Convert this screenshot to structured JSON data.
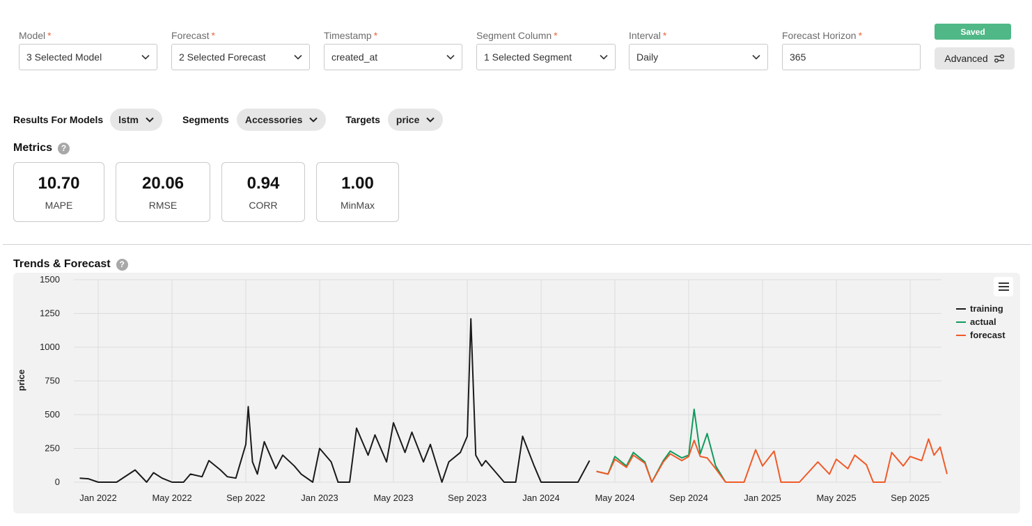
{
  "fields": [
    {
      "label": "Model",
      "value": "3 Selected Model",
      "kind": "select"
    },
    {
      "label": "Forecast",
      "value": "2 Selected Forecast",
      "kind": "select"
    },
    {
      "label": "Timestamp",
      "value": "created_at",
      "kind": "select"
    },
    {
      "label": "Segment Column",
      "value": "1 Selected Segment",
      "kind": "select"
    },
    {
      "label": "Interval",
      "value": "Daily",
      "kind": "select"
    },
    {
      "label": "Forecast Horizon",
      "value": "365",
      "kind": "input"
    }
  ],
  "required_mark": "*",
  "saved_label": "Saved",
  "advanced_label": "Advanced",
  "filters": {
    "models_label": "Results For Models",
    "models_value": "lstm",
    "segments_label": "Segments",
    "segments_value": "Accessories",
    "targets_label": "Targets",
    "targets_value": "price"
  },
  "metrics_title": "Metrics",
  "help_glyph": "?",
  "metrics": [
    {
      "value": "10.70",
      "name": "MAPE"
    },
    {
      "value": "20.06",
      "name": "RMSE"
    },
    {
      "value": "0.94",
      "name": "CORR"
    },
    {
      "value": "1.00",
      "name": "MinMax"
    }
  ],
  "chart_title": "Trends & Forecast",
  "chart_data": {
    "type": "line",
    "ylabel": "price",
    "ylim": [
      0,
      1500
    ],
    "yticks": [
      0,
      250,
      500,
      750,
      1000,
      1250,
      1500
    ],
    "xticks": [
      "Jan 2022",
      "May 2022",
      "Sep 2022",
      "Jan 2023",
      "May 2023",
      "Sep 2023",
      "Jan 2024",
      "May 2024",
      "Sep 2024",
      "Jan 2025",
      "May 2025",
      "Sep 2025"
    ],
    "grid": true,
    "legend_position": "right",
    "series": [
      {
        "name": "training",
        "color": "#1a1a1a",
        "x": [
          "2021-12-01",
          "2021-12-15",
          "2022-01-01",
          "2022-02-01",
          "2022-03-01",
          "2022-03-20",
          "2022-04-01",
          "2022-04-15",
          "2022-05-01",
          "2022-05-20",
          "2022-06-01",
          "2022-06-20",
          "2022-07-01",
          "2022-07-20",
          "2022-08-01",
          "2022-08-15",
          "2022-09-01",
          "2022-09-05",
          "2022-09-12",
          "2022-09-20",
          "2022-10-01",
          "2022-10-20",
          "2022-11-01",
          "2022-11-20",
          "2022-12-01",
          "2022-12-20",
          "2023-01-01",
          "2023-01-20",
          "2023-02-01",
          "2023-02-20",
          "2023-03-01",
          "2023-03-20",
          "2023-04-01",
          "2023-04-20",
          "2023-05-01",
          "2023-05-20",
          "2023-06-01",
          "2023-06-20",
          "2023-07-01",
          "2023-07-20",
          "2023-08-01",
          "2023-08-20",
          "2023-09-01",
          "2023-09-07",
          "2023-09-15",
          "2023-09-25",
          "2023-10-01",
          "2023-10-20",
          "2023-11-01",
          "2023-11-20",
          "2023-12-01",
          "2023-12-20",
          "2024-01-01",
          "2024-02-01",
          "2024-03-01",
          "2024-03-20"
        ],
        "y": [
          30,
          25,
          0,
          0,
          90,
          0,
          70,
          30,
          0,
          0,
          60,
          40,
          160,
          90,
          40,
          30,
          280,
          560,
          150,
          60,
          300,
          100,
          200,
          120,
          60,
          0,
          250,
          150,
          0,
          0,
          400,
          200,
          350,
          150,
          440,
          220,
          370,
          150,
          280,
          0,
          150,
          220,
          340,
          1210,
          200,
          120,
          160,
          60,
          0,
          0,
          340,
          120,
          0,
          0,
          0,
          160
        ]
      },
      {
        "name": "actual",
        "color": "#0f9a5c",
        "x": [
          "2024-04-01",
          "2024-04-20",
          "2024-05-01",
          "2024-05-20",
          "2024-06-01",
          "2024-06-20",
          "2024-07-01",
          "2024-07-20",
          "2024-08-01",
          "2024-08-20",
          "2024-09-01",
          "2024-09-10",
          "2024-09-20",
          "2024-10-01",
          "2024-10-15",
          "2024-11-01"
        ],
        "y": [
          80,
          60,
          190,
          120,
          220,
          150,
          0,
          160,
          230,
          180,
          200,
          540,
          210,
          360,
          120,
          0
        ]
      },
      {
        "name": "forecast",
        "color": "#f05a28",
        "x": [
          "2024-04-01",
          "2024-04-20",
          "2024-05-01",
          "2024-05-20",
          "2024-06-01",
          "2024-06-20",
          "2024-07-01",
          "2024-07-20",
          "2024-08-01",
          "2024-08-20",
          "2024-09-01",
          "2024-09-10",
          "2024-09-20",
          "2024-10-01",
          "2024-10-15",
          "2024-11-01",
          "2024-12-01",
          "2024-12-20",
          "2025-01-01",
          "2025-01-20",
          "2025-02-01",
          "2025-03-01",
          "2025-04-01",
          "2025-04-20",
          "2025-05-01",
          "2025-05-20",
          "2025-06-01",
          "2025-06-20",
          "2025-07-01",
          "2025-07-20",
          "2025-08-01",
          "2025-08-20",
          "2025-09-01",
          "2025-09-20",
          "2025-10-01",
          "2025-10-10",
          "2025-10-20",
          "2025-11-01"
        ],
        "y": [
          80,
          60,
          170,
          110,
          200,
          140,
          0,
          150,
          210,
          160,
          190,
          310,
          190,
          180,
          100,
          0,
          0,
          240,
          120,
          230,
          0,
          0,
          150,
          60,
          170,
          100,
          200,
          130,
          0,
          0,
          220,
          120,
          190,
          160,
          320,
          200,
          260,
          60
        ]
      }
    ]
  }
}
